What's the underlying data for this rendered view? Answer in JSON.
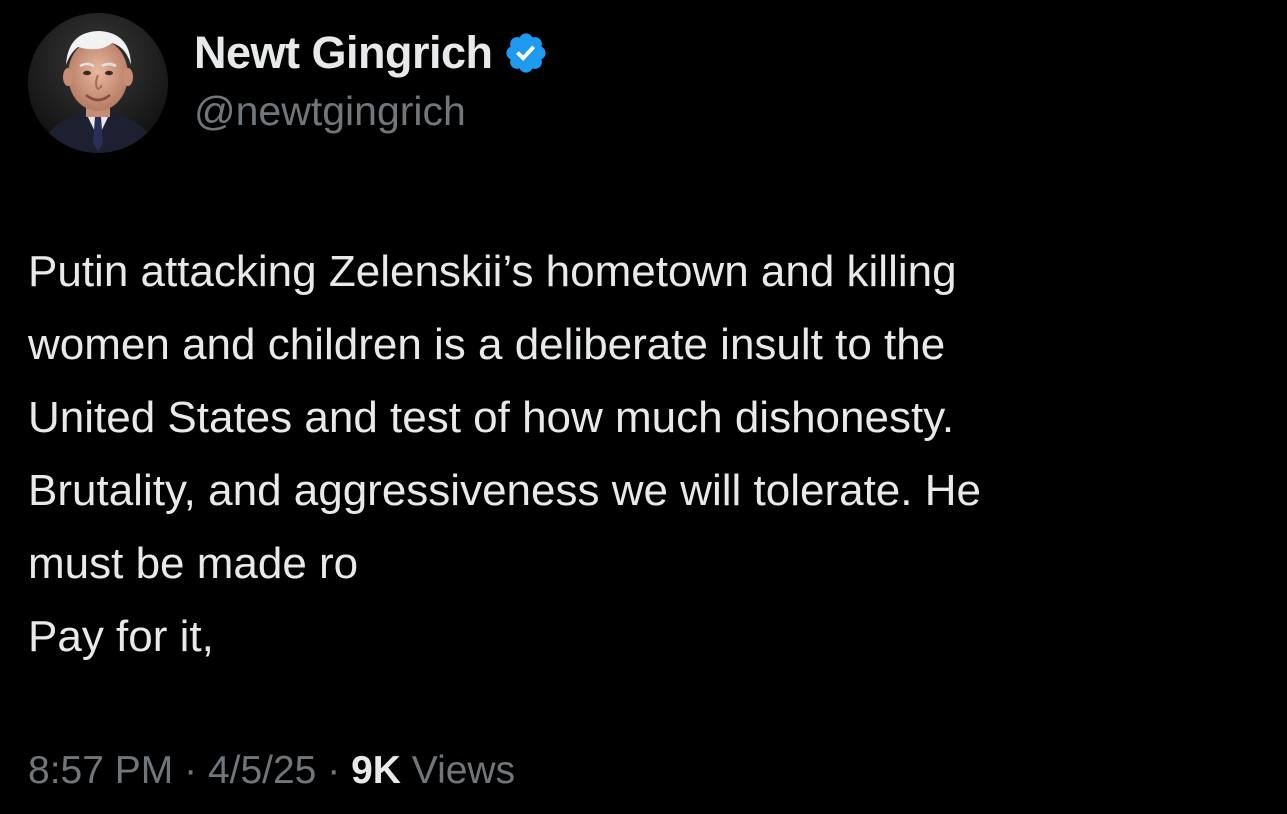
{
  "author": {
    "display_name": "Newt Gingrich",
    "handle": "@newtgingrich",
    "verified_icon": "verified-badge-icon",
    "verified_color": "#1d9bf0"
  },
  "tweet": {
    "lines": [
      "Putin attacking Zelenskii’s hometown and killing",
      "women and children is a deliberate insult to the",
      "United States and test of how much dishonesty.",
      "Brutality, and aggressiveness we will tolerate. He",
      "must be made ro",
      "Pay for it,"
    ]
  },
  "meta": {
    "time": "8:57 PM",
    "separator": "·",
    "date": "4/5/25",
    "views_count": "9K",
    "views_label": "Views"
  },
  "colors": {
    "background": "#000000",
    "primary_text": "#e7e9ea",
    "secondary_text": "#71767b"
  }
}
